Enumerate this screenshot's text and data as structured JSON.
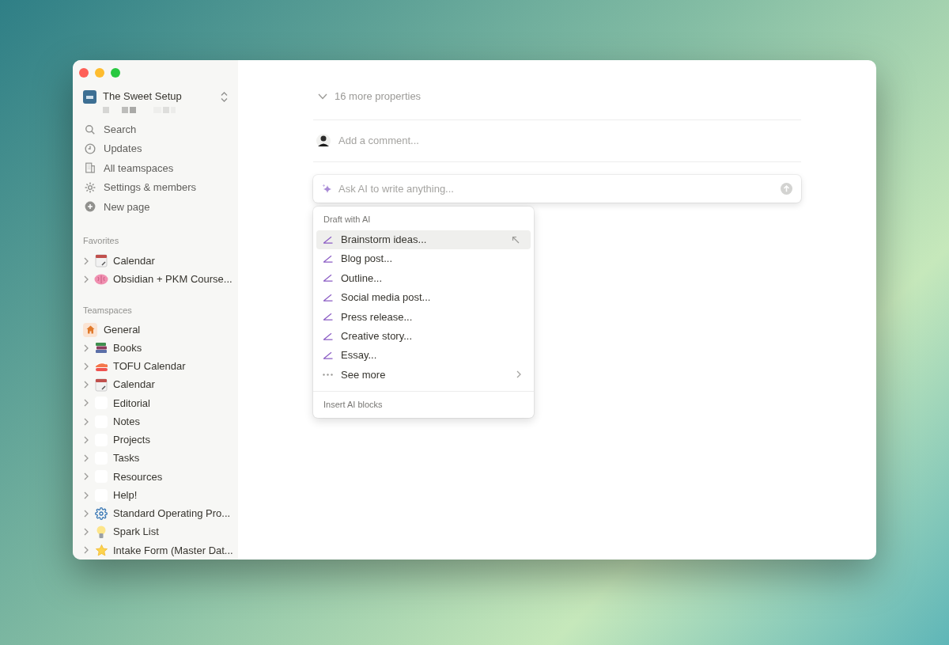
{
  "workspace": {
    "name": "The Sweet Setup"
  },
  "nav": [
    {
      "label": "Search"
    },
    {
      "label": "Updates"
    },
    {
      "label": "All teamspaces"
    },
    {
      "label": "Settings & members"
    },
    {
      "label": "New page"
    }
  ],
  "favorites": {
    "heading": "Favorites",
    "items": [
      {
        "label": "Calendar"
      },
      {
        "label": "Obsidian + PKM Course..."
      }
    ]
  },
  "teamspaces": {
    "heading": "Teamspaces",
    "items": [
      {
        "label": "General",
        "kind": "teamspace"
      },
      {
        "label": "Books",
        "kind": "page"
      },
      {
        "label": "TOFU Calendar",
        "kind": "page"
      },
      {
        "label": "Calendar",
        "kind": "page"
      },
      {
        "label": "Editorial",
        "kind": "page"
      },
      {
        "label": "Notes",
        "kind": "page"
      },
      {
        "label": "Projects",
        "kind": "page"
      },
      {
        "label": "Tasks",
        "kind": "page"
      },
      {
        "label": "Resources",
        "kind": "page"
      },
      {
        "label": "Help!",
        "kind": "page"
      },
      {
        "label": "Standard Operating Pro...",
        "kind": "page"
      },
      {
        "label": "Spark List",
        "kind": "page"
      },
      {
        "label": "Intake Form (Master Dat...",
        "kind": "page"
      }
    ]
  },
  "page": {
    "properties_toggle": "16 more properties",
    "comment": {
      "placeholder": "Add a comment..."
    },
    "ai_input": {
      "placeholder": "Ask AI to write anything..."
    }
  },
  "ai_menu": {
    "sections": [
      {
        "heading": "Draft with AI",
        "items": [
          {
            "label": "Brainstorm ideas...",
            "kind": "draft",
            "selected": true
          },
          {
            "label": "Blog post...",
            "kind": "draft",
            "selected": false
          },
          {
            "label": "Outline...",
            "kind": "draft",
            "selected": false
          },
          {
            "label": "Social media post...",
            "kind": "draft",
            "selected": false
          },
          {
            "label": "Press release...",
            "kind": "draft",
            "selected": false
          },
          {
            "label": "Creative story...",
            "kind": "draft",
            "selected": false
          },
          {
            "label": "Essay...",
            "kind": "draft",
            "selected": false
          },
          {
            "label": "See more",
            "kind": "more",
            "selected": false
          }
        ]
      },
      {
        "heading": "Insert AI blocks"
      }
    ]
  }
}
